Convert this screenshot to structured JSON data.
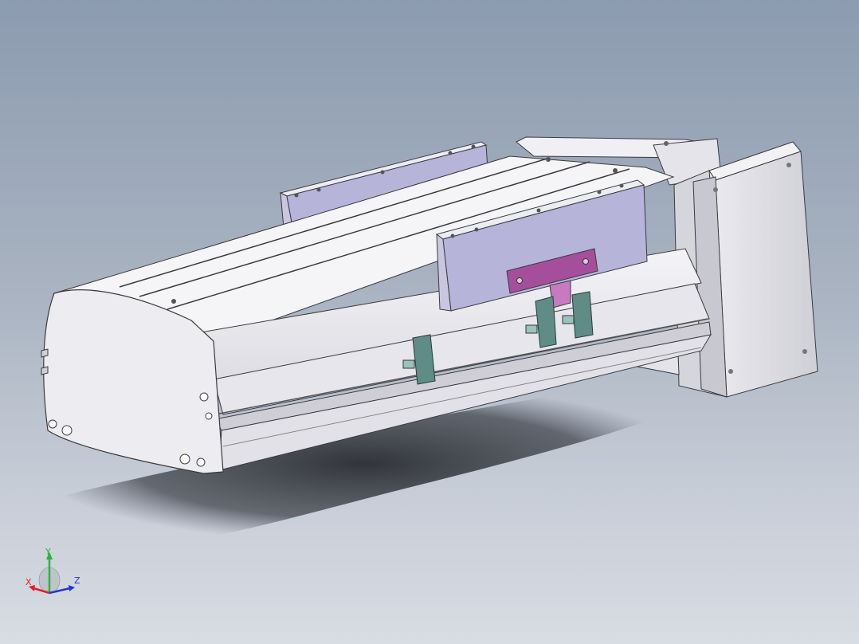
{
  "viewport": {
    "background_top": "#8c9bb0",
    "background_bottom": "#d8dce3"
  },
  "model": {
    "body_color": "#f2f2f5",
    "edge_color": "#3a3a40",
    "bracket_color": "#b3b0d6",
    "clamp_color": "#a54f9c",
    "hook_color": "#5f8c86",
    "motor_color": "#e6e6ea"
  },
  "triad": {
    "x_label": "X",
    "y_label": "Y",
    "z_label": "Z",
    "x_color": "#e0202a",
    "y_color": "#2fb33a",
    "z_color": "#2036d8"
  }
}
